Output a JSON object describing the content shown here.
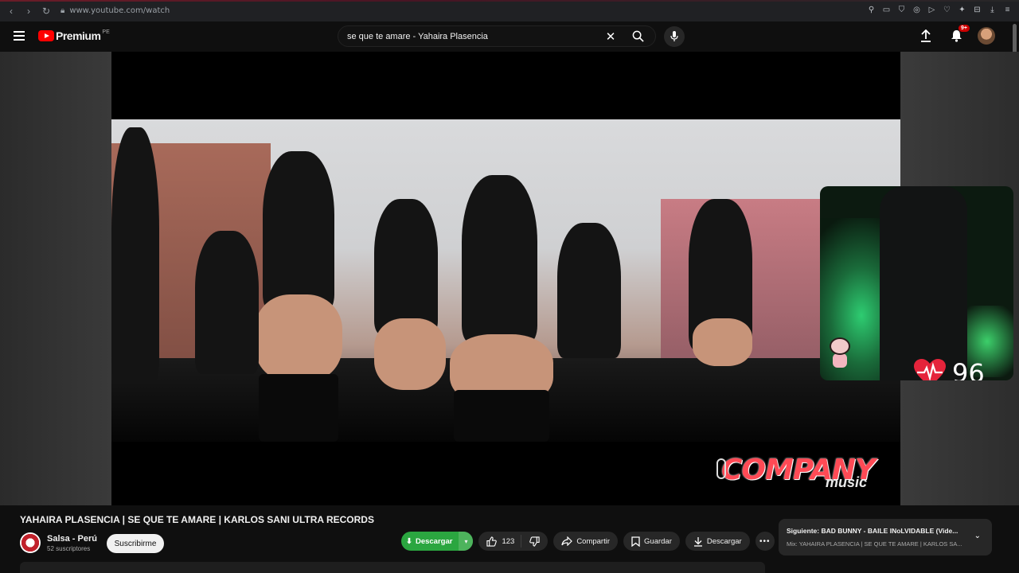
{
  "browser": {
    "url": "www.youtube.com/watch",
    "extension_icons": [
      "pin-icon",
      "reader-icon",
      "shield-icon",
      "vpn-icon",
      "play-icon",
      "heart-icon",
      "puzzle-icon",
      "wallet-icon",
      "download-icon",
      "menu-icon"
    ]
  },
  "header": {
    "logo_text": "Premium",
    "region": "PE",
    "search_query": "se que te amare - Yahaira Plasencia",
    "notifications_badge": "9+"
  },
  "video": {
    "watermark_main": "COMPANY",
    "watermark_sub": "music"
  },
  "overlay": {
    "heart_rate": "96"
  },
  "details": {
    "title": "YAHAIRA PLASENCIA | SE QUE TE AMARE | KARLOS SANI ULTRA RECORDS",
    "channel_name": "Salsa - Perú",
    "subscribers": "52 suscriptores",
    "subscribe_label": "Suscribirme",
    "download_green_label": "Descargar",
    "like_count": "123",
    "share_label": "Compartir",
    "save_label": "Guardar",
    "download_label": "Descargar"
  },
  "next_up": {
    "line1": "Siguiente: BAD BUNNY - BAILE INoLVIDABLE (Vide...",
    "line2": "Mix: YAHAIRA PLASENCIA | SE QUE TE AMARE | KARLOS SA..."
  },
  "colors": {
    "youtube_red": "#ff0000",
    "download_green": "#2ba640",
    "watermark_red": "#ff4a55"
  }
}
